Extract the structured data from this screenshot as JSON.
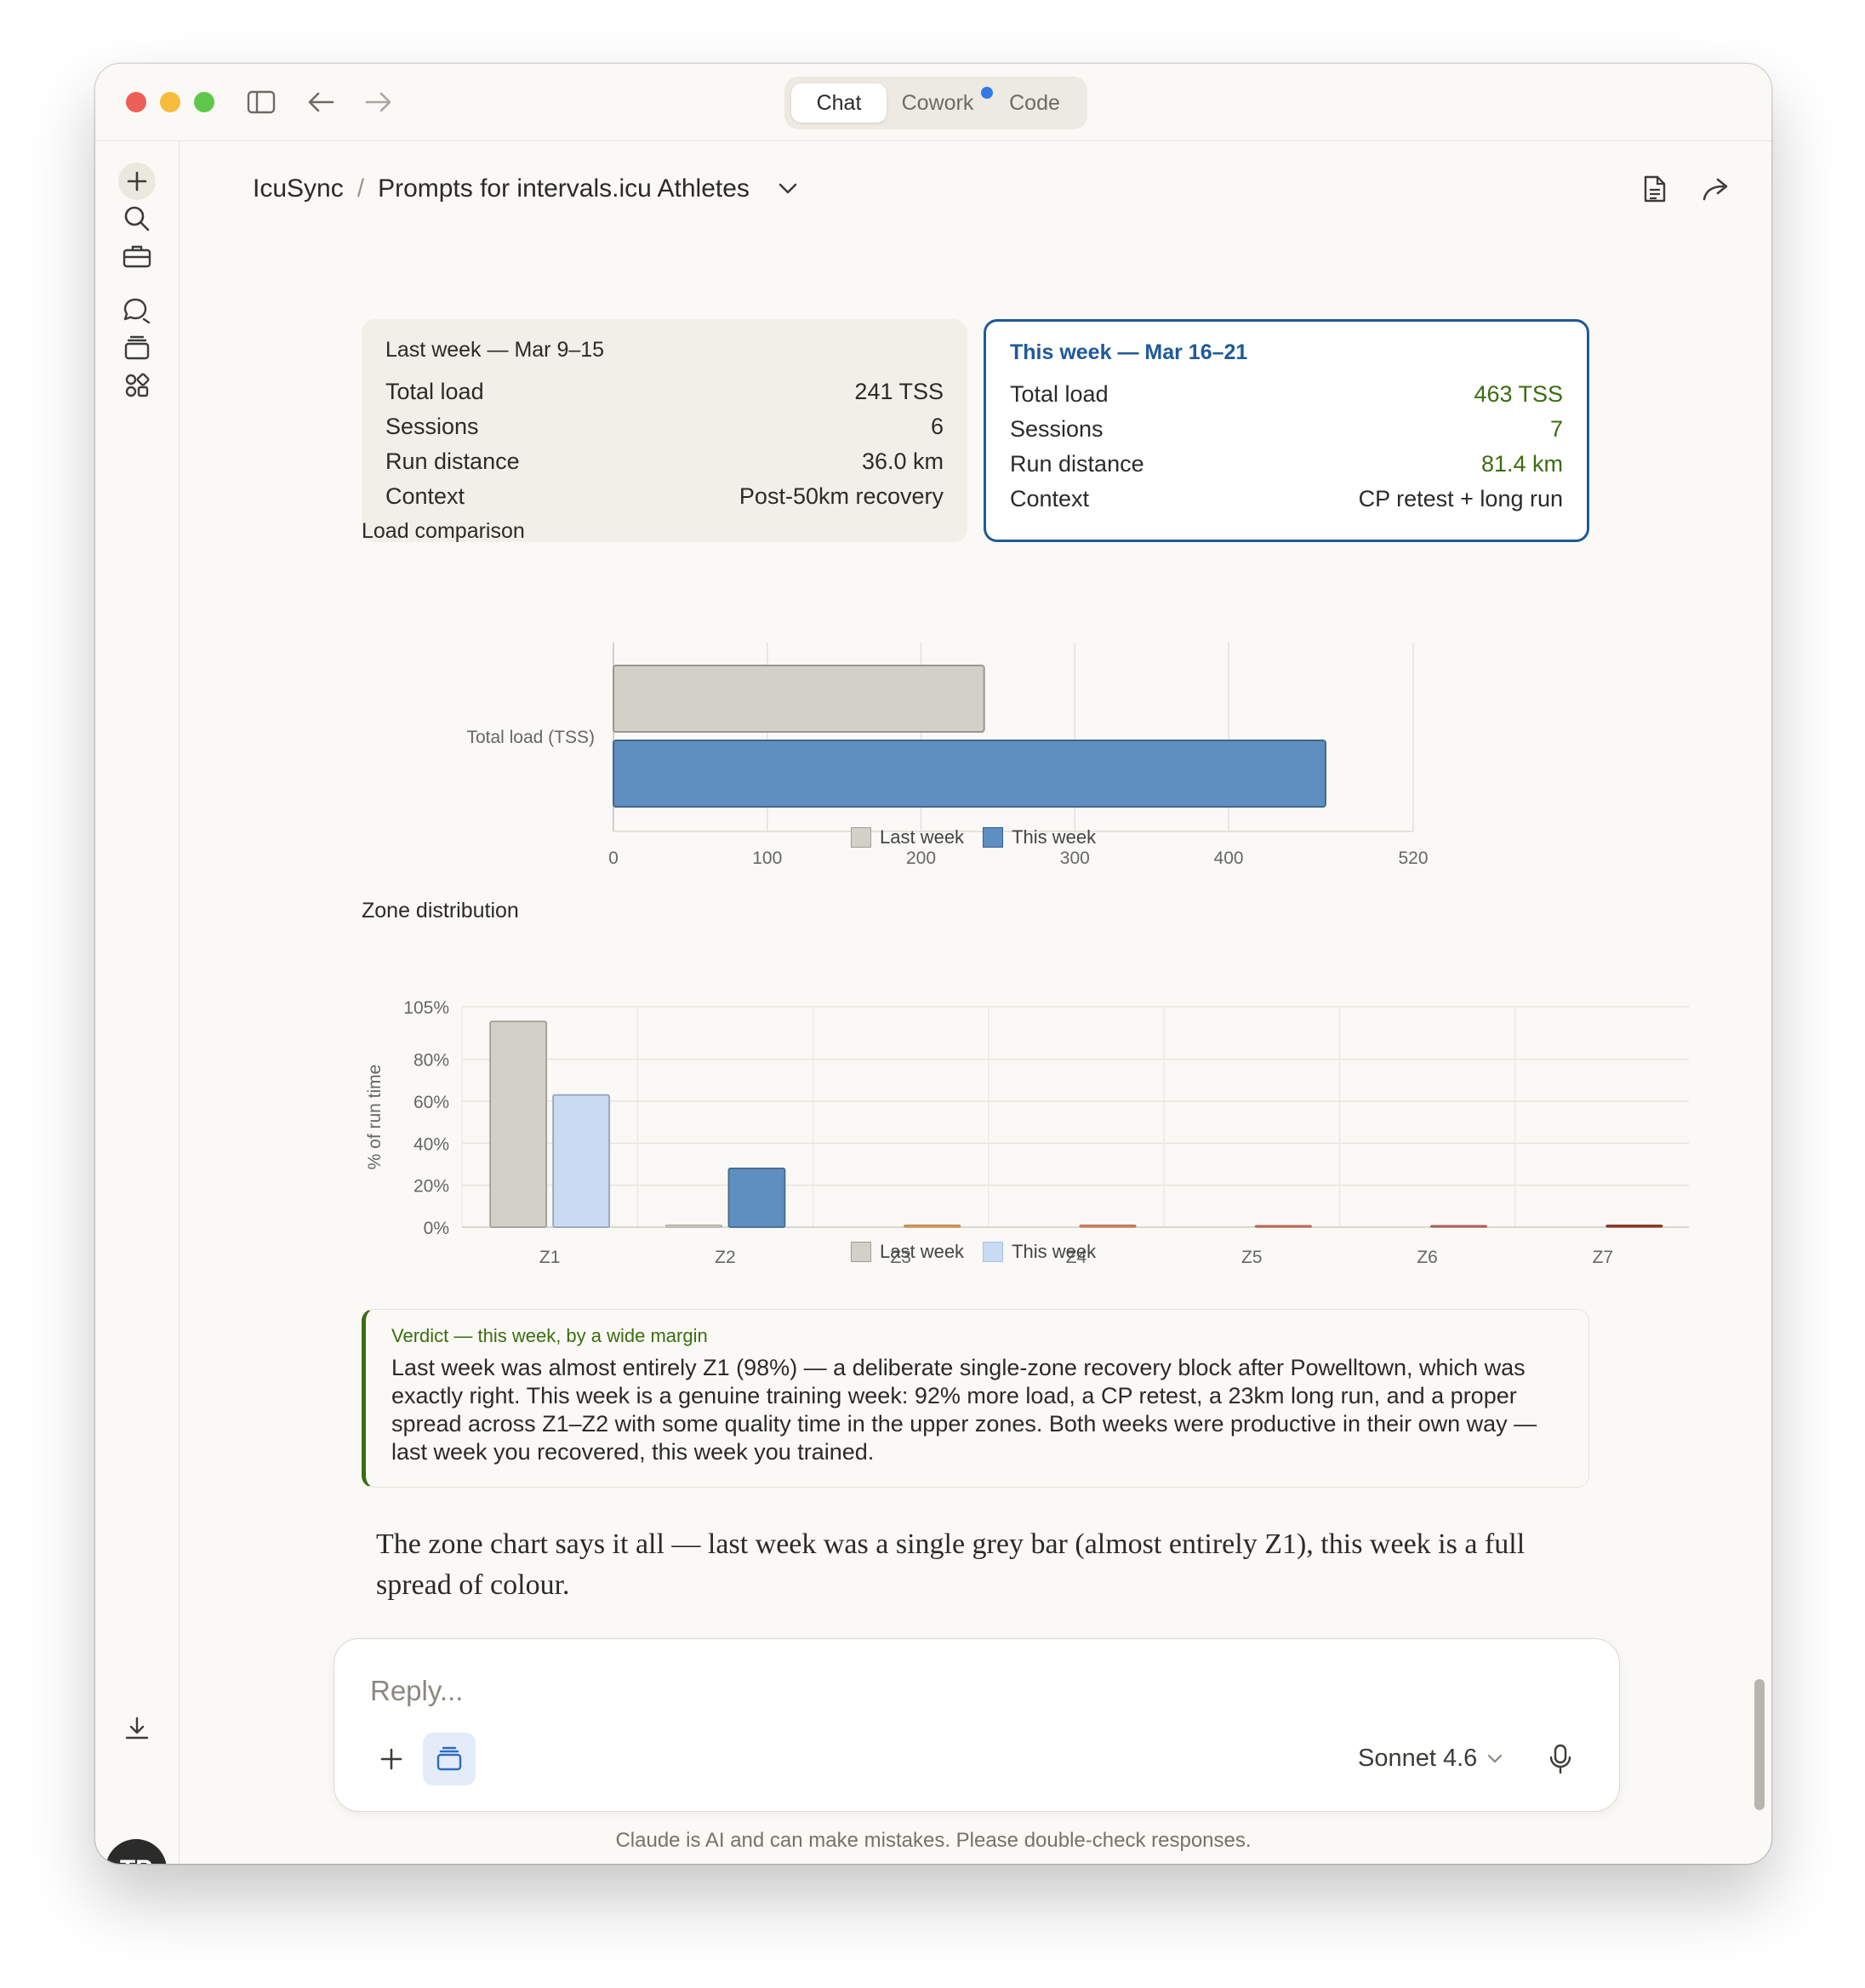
{
  "window": {
    "modes": [
      "Chat",
      "Cowork",
      "Code"
    ],
    "active_mode": "Chat"
  },
  "breadcrumb": {
    "project": "IcuSync",
    "separator": "/",
    "conversation": "Prompts for intervals.icu Athletes"
  },
  "cards": {
    "last": {
      "title": "Last week — Mar 9–15",
      "rows": [
        {
          "label": "Total load",
          "value": "241 TSS"
        },
        {
          "label": "Sessions",
          "value": "6"
        },
        {
          "label": "Run distance",
          "value": "36.0 km"
        },
        {
          "label": "Context",
          "value": "Post-50km recovery"
        }
      ]
    },
    "this": {
      "title": "This week — Mar 16–21",
      "rows": [
        {
          "label": "Total load",
          "value": "463 TSS"
        },
        {
          "label": "Sessions",
          "value": "7"
        },
        {
          "label": "Run distance",
          "value": "81.4 km"
        },
        {
          "label": "Context",
          "value": "CP retest + long run"
        }
      ]
    }
  },
  "chart_data": [
    {
      "type": "bar",
      "orientation": "horizontal",
      "title": "Load comparison",
      "categories": [
        "Total load (TSS)"
      ],
      "series": [
        {
          "name": "Last week",
          "values": [
            241
          ],
          "color": "#d3d1c7"
        },
        {
          "name": "This week",
          "values": [
            463
          ],
          "color": "#5f8fc1"
        }
      ],
      "xlim": [
        0,
        520
      ],
      "xticks": [
        0,
        100,
        200,
        300,
        400,
        520
      ],
      "grid": true,
      "legend": "bottom-center"
    },
    {
      "type": "bar",
      "title": "Zone distribution",
      "ylabel": "% of run time",
      "categories": [
        "Z1",
        "Z2",
        "Z3",
        "Z4",
        "Z5",
        "Z6",
        "Z7"
      ],
      "series": [
        {
          "name": "Last week",
          "values": [
            98,
            1,
            0,
            0,
            0,
            0,
            0
          ],
          "color": "#d3d1c7"
        },
        {
          "name": "This week",
          "values": [
            63,
            28,
            1,
            1,
            0.5,
            0.5,
            1
          ],
          "colors": [
            "#c8dbf2",
            "#5f8fc1",
            "#e8a25f",
            "#e38a5e",
            "#dd7464",
            "#c96b66",
            "#a03c2e"
          ]
        }
      ],
      "ylim": [
        0,
        105
      ],
      "yticks": [
        0,
        20,
        40,
        60,
        80,
        105
      ],
      "ytick_format": "{v}%",
      "grid": true,
      "legend": "bottom-center",
      "legend_colors": [
        "#d3d1c7",
        "#c8dbf2"
      ]
    }
  ],
  "verdict": {
    "title": "Verdict — this week, by a wide margin",
    "body": "Last week was almost entirely Z1 (98%) — a deliberate single-zone recovery block after Powelltown, which was exactly right. This week is a genuine training week: 92% more load, a CP retest, a 23km long run, and a proper spread across Z1–Z2 with some quality time in the upper zones. Both weeks were productive in their own way — last week you recovered, this week you trained."
  },
  "message": "The zone chart says it all — last week was a single grey bar (almost entirely Z1), this week is a full spread of colour.",
  "composer": {
    "placeholder": "Reply...",
    "model": "Sonnet 4.6"
  },
  "disclaimer": "Claude is AI and can make mistakes. Please double-check responses.",
  "user": {
    "initials": "TP"
  }
}
